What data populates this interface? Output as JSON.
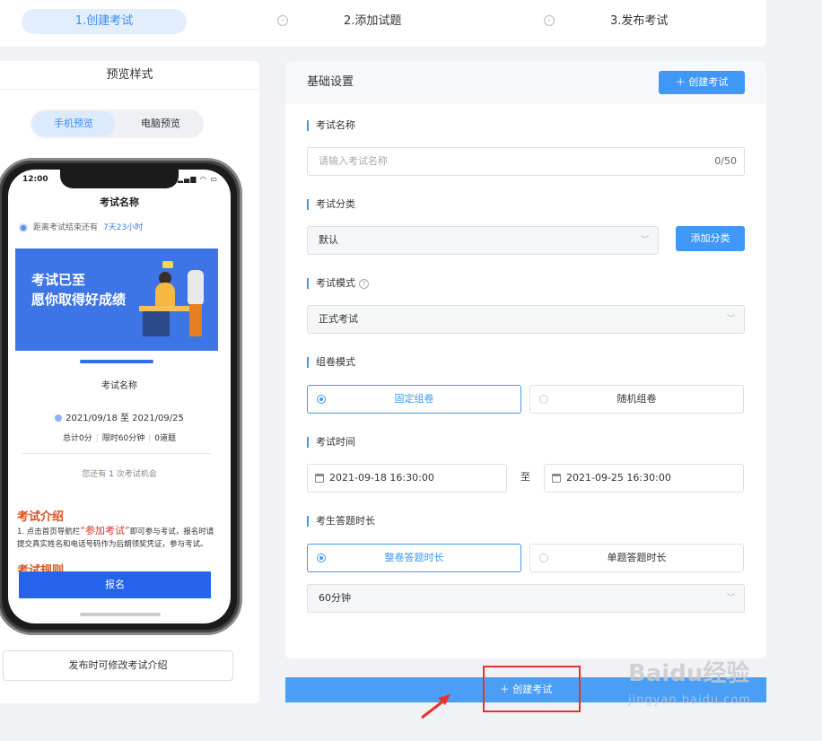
{
  "steps": {
    "step1": "1.创建考试",
    "step2": "2.添加试题",
    "step3": "3.发布考试"
  },
  "preview": {
    "title": "预览样式",
    "toggle_mobile": "手机预览",
    "toggle_pc": "电脑预览",
    "publish_note": "发布时可修改考试介绍"
  },
  "mobile": {
    "status_time": "12:00",
    "exam_title": "考试名称",
    "countdown_label": "距离考试结束还有",
    "countdown_value": "7天23小时",
    "banner_line1": "考试已至",
    "banner_line2": "愿你取得好成绩",
    "sub_title": "考试名称",
    "date_range": "2021/09/18 至 2021/09/25",
    "stat_total": "总计0分",
    "stat_time": "限时60分钟",
    "stat_questions": "0道题",
    "chance_prefix": "您还有",
    "chance_count": "1",
    "chance_suffix": "次考试机会",
    "intro_heading": "考试介绍",
    "intro_text_a": "1. 点击首页导航栏",
    "intro_text_highlight": "“参加考试”",
    "intro_text_b": "即可参与考试，报名时请提交真实姓名和电话号码作为后期领奖凭证，参与考试。",
    "rules_heading": "考试规则",
    "signup_button": "报名"
  },
  "form": {
    "header_title": "基础设置",
    "create_button": "＋ 创建考试",
    "name_label": "考试名称",
    "name_placeholder": "请输入考试名称",
    "name_counter": "0/50",
    "category_label": "考试分类",
    "category_value": "默认",
    "add_category_button": "添加分类",
    "mode_label": "考试模式",
    "mode_value": "正式考试",
    "compose_label": "组卷模式",
    "compose_fixed": "固定组卷",
    "compose_random": "随机组卷",
    "time_label": "考试时间",
    "time_start": "2021-09-18 16:30:00",
    "time_to": "至",
    "time_end": "2021-09-25 16:30:00",
    "duration_label": "考生答题时长",
    "duration_whole": "整卷答题时长",
    "duration_single": "单题答题时长",
    "duration_value": "60分钟"
  },
  "bottom": {
    "create_button": "＋ 创建考试"
  },
  "watermark": {
    "brand": "Baidu经验",
    "url": "jingyan.baidu.com"
  },
  "colors": {
    "accent": "#3f97f8",
    "highlight_red": "#e8332b"
  }
}
